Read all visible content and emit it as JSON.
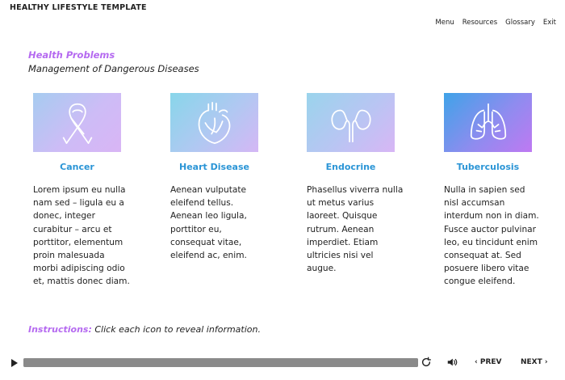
{
  "app": {
    "title": "HEALTHY LIFESTYLE TEMPLATE"
  },
  "menu": {
    "items": [
      "Menu",
      "Resources",
      "Glossary",
      "Exit"
    ]
  },
  "section": {
    "title": "Health Problems",
    "subtitle": "Management of Dangerous Diseases"
  },
  "cards": [
    {
      "title": "Cancer",
      "icon": "ribbon-icon",
      "body": "Lorem ipsum eu nulla nam sed – ligula eu a donec, integer curabitur – arcu et porttitor, elementum proin malesuada morbi adipiscing odio et, mattis donec diam."
    },
    {
      "title": "Heart Disease",
      "icon": "heart-icon",
      "body": "Aenean vulputate eleifend tellus. Aenean leo ligula, porttitor eu, consequat vitae, eleifend ac, enim."
    },
    {
      "title": "Endocrine",
      "icon": "kidneys-icon",
      "body": "Phasellus viverra nulla ut metus varius laoreet. Quisque rutrum. Aenean imperdiet. Etiam ultricies nisi vel augue."
    },
    {
      "title": "Tuberculosis",
      "icon": "lungs-icon",
      "body": "Nulla in sapien sed nisl accumsan interdum non in diam. Fusce auctor pulvinar leo, eu tincidunt enim consequat at. Sed posuere libero vitae congue eleifend."
    }
  ],
  "instructions": {
    "label": "Instructions:",
    "text": "Click each icon to reveal information."
  },
  "player": {
    "prev_label": "PREV",
    "next_label": "NEXT",
    "progress": 1.0
  },
  "colors": {
    "accent": "#b56af0",
    "card_title": "#2b95d6"
  }
}
